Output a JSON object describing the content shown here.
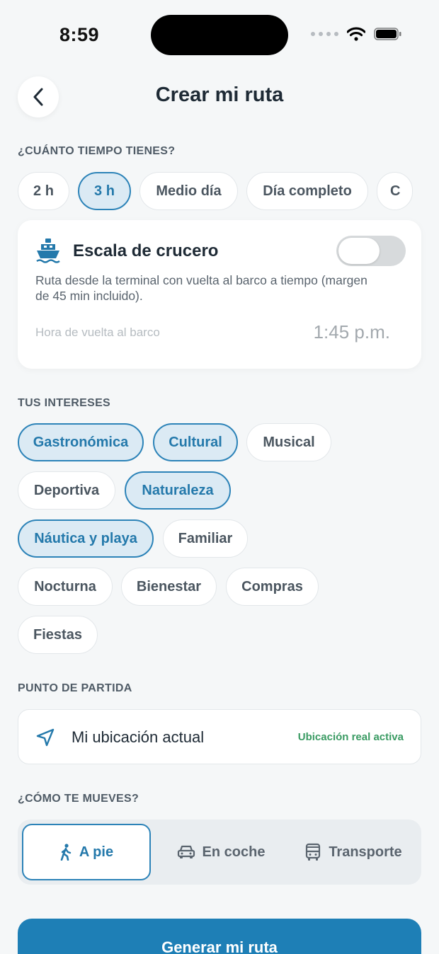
{
  "status_bar": {
    "time": "8:59"
  },
  "header": {
    "title": "Crear mi ruta"
  },
  "time_section": {
    "label": "¿CUÁNTO TIEMPO TIENES?",
    "options": [
      "2 h",
      "3 h",
      "Medio día",
      "Día completo",
      "C"
    ],
    "selected": "3 h"
  },
  "cruise": {
    "title": "Escala de crucero",
    "description": "Ruta desde la terminal con vuelta al barco a tiempo (margen de 45 min incluido).",
    "return_label": "Hora de vuelta al barco",
    "return_time": "1:45 p.m.",
    "enabled": false
  },
  "interests": {
    "label": "TUS INTERESES",
    "items": [
      "Gastronómica",
      "Cultural",
      "Musical",
      "Deportiva",
      "Naturaleza",
      "Náutica y playa",
      "Familiar",
      "Nocturna",
      "Bienestar",
      "Compras",
      "Fiestas"
    ],
    "selected": [
      "Gastronómica",
      "Cultural",
      "Naturaleza",
      "Náutica y playa"
    ]
  },
  "start_point": {
    "label": "PUNTO DE PARTIDA",
    "value": "Mi ubicación actual",
    "badge": "Ubicación real activa"
  },
  "transport": {
    "label": "¿CÓMO TE MUEVES?",
    "options": [
      "A pie",
      "En coche",
      "Transporte"
    ],
    "selected": "A pie"
  },
  "cta": {
    "label": "Generar mi ruta"
  },
  "colors": {
    "accent": "#2479ab",
    "selected_bg": "#dbeaf4",
    "success": "#3a9b63",
    "cta": "#1e7fb6"
  }
}
